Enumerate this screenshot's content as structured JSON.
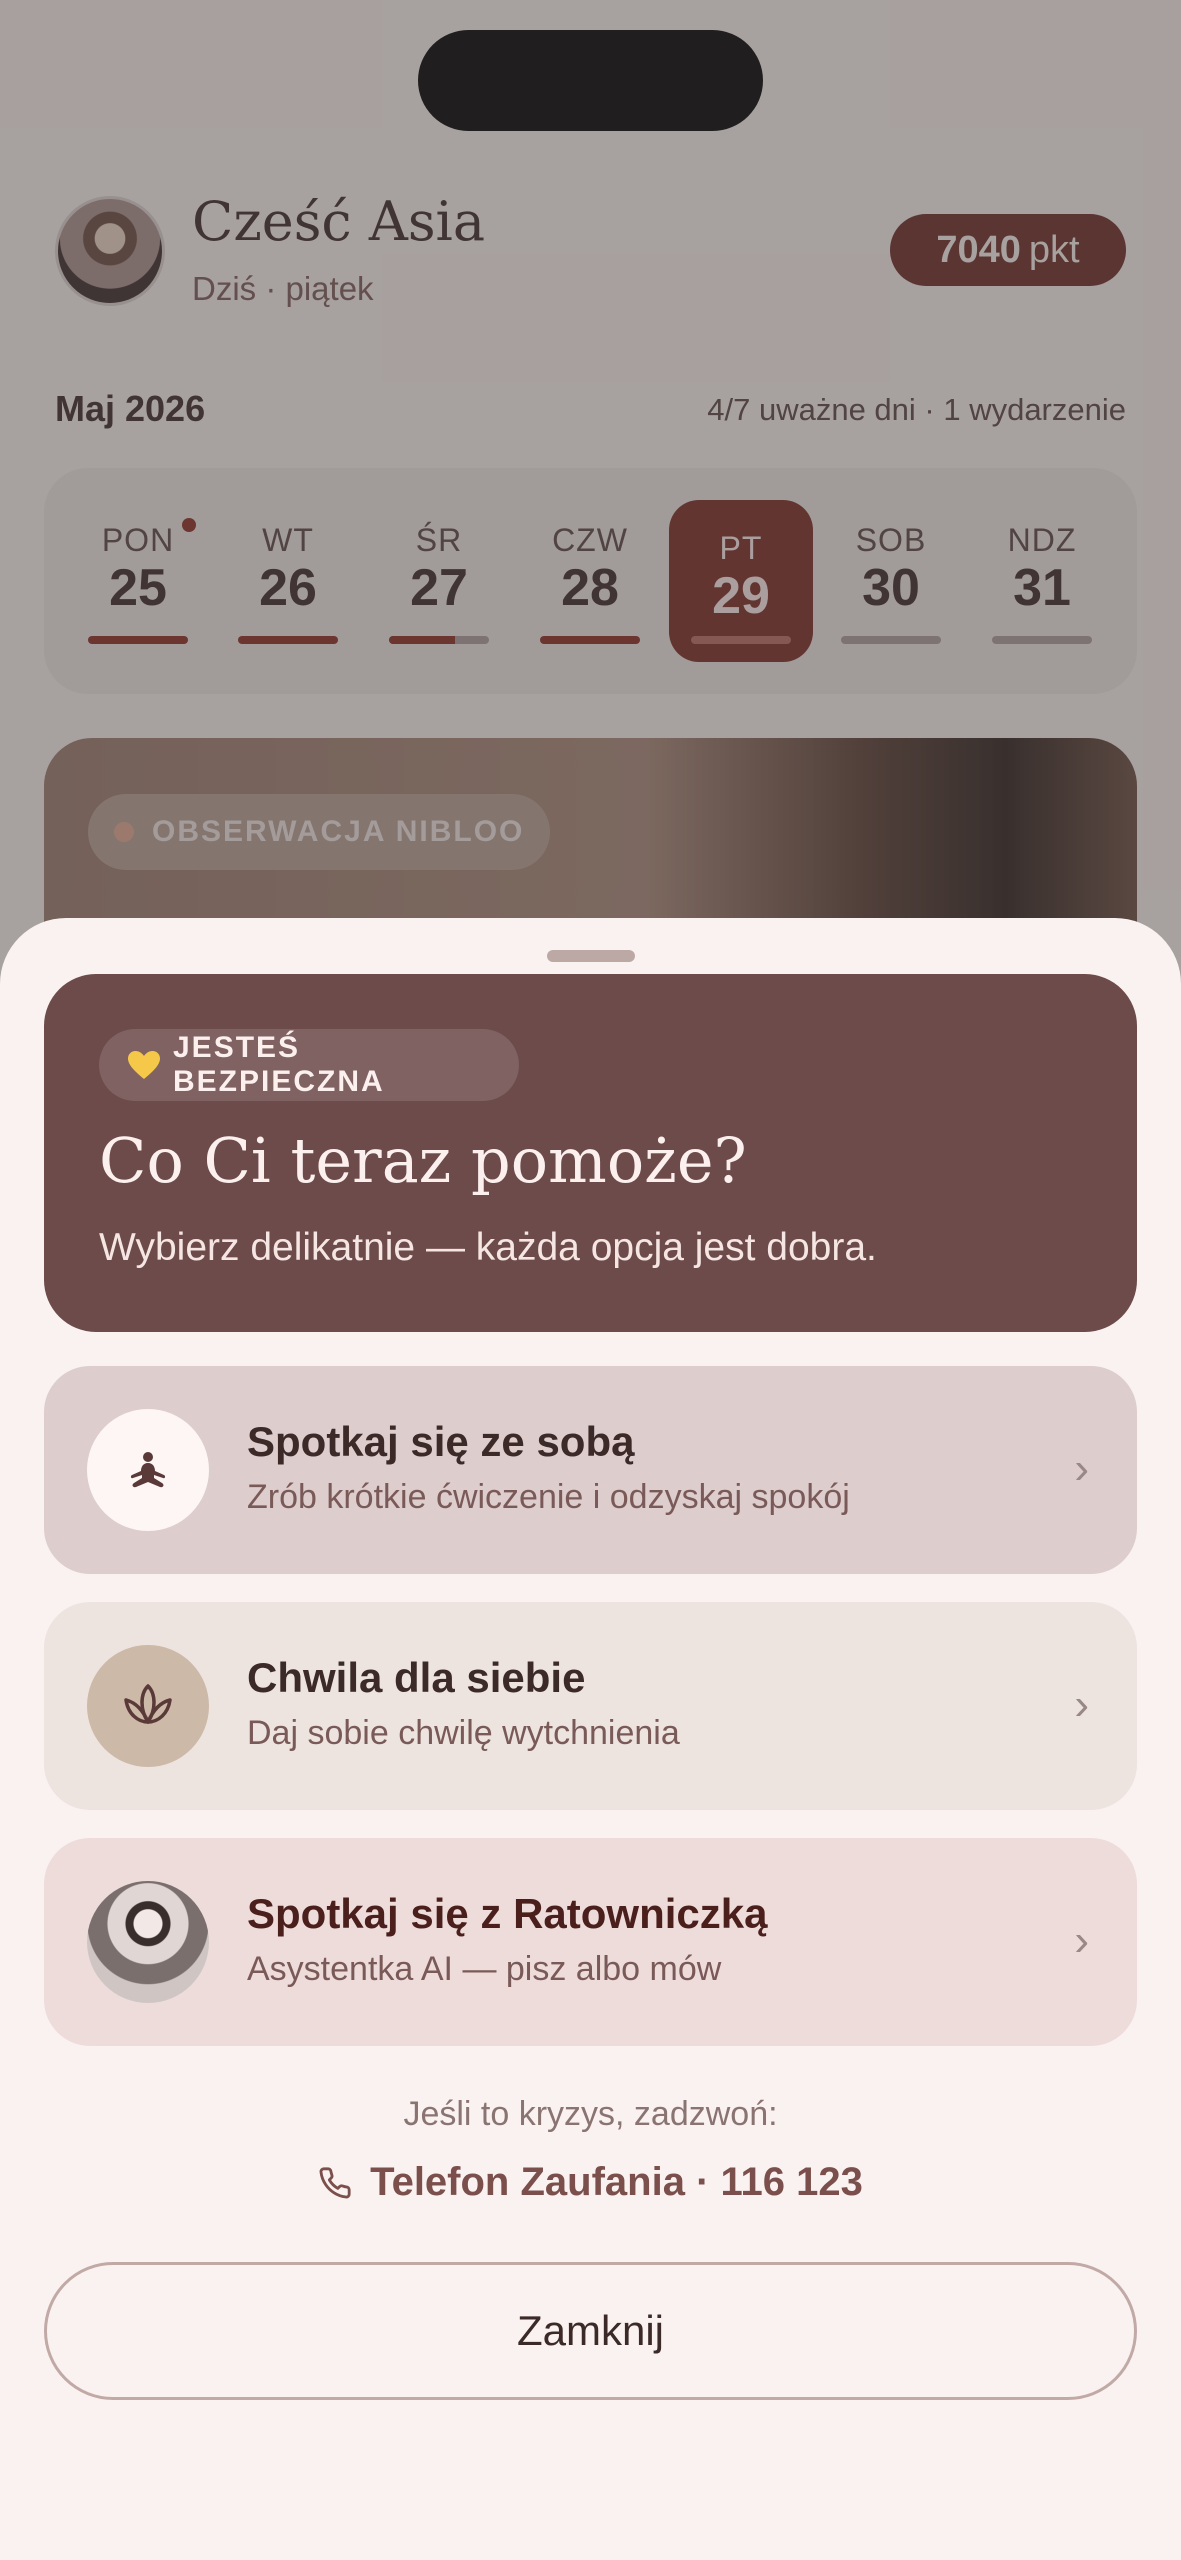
{
  "header": {
    "greeting": "Cześć Asia",
    "subtitle": "Dziś · piątek",
    "points_value": "7040",
    "points_unit": "pkt"
  },
  "calendar": {
    "month": "Maj 2026",
    "stats": "4/7 uważne dni  ·  1 wydarzenie",
    "days": [
      {
        "name": "PON",
        "date": "25",
        "progress": 1.0,
        "has_dot": true
      },
      {
        "name": "WT",
        "date": "26",
        "progress": 1.0
      },
      {
        "name": "ŚR",
        "date": "27",
        "progress": 0.66
      },
      {
        "name": "CZW",
        "date": "28",
        "progress": 1.0
      },
      {
        "name": "PT",
        "date": "29",
        "progress": 0.0,
        "selected": true
      },
      {
        "name": "SOB",
        "date": "30",
        "progress": 0.0
      },
      {
        "name": "NDZ",
        "date": "31",
        "progress": 0.0
      }
    ]
  },
  "observation": {
    "label": "OBSERWACJA NIBLOO"
  },
  "sheet": {
    "badge": "JESTEŚ BEZPIECZNA",
    "badge_icon": "yellow-heart-icon",
    "title": "Co Ci teraz pomoże?",
    "subtitle": "Wybierz delikatnie — każda opcja jest dobra.",
    "options": [
      {
        "title": "Spotkaj się ze sobą",
        "subtitle": "Zrób krótkie ćwiczenie i odzyskaj spokój",
        "icon": "meditation-icon"
      },
      {
        "title": "Chwila dla siebie",
        "subtitle": "Daj sobie chwilę wytchnienia",
        "icon": "lotus-icon"
      },
      {
        "title": "Spotkaj się z Ratowniczką",
        "subtitle": "Asystentka AI — pisz albo mów",
        "icon": "assistant-avatar"
      }
    ],
    "crisis_text": "Jeśli to kryzys, zadzwoń:",
    "hotline": "Telefon Zaufania · 116 123",
    "close_label": "Zamknij",
    "chevron": "›"
  },
  "colors": {
    "accent": "#6b2b24",
    "hero": "#6c4b4a",
    "sheet": "#faf2f0"
  }
}
